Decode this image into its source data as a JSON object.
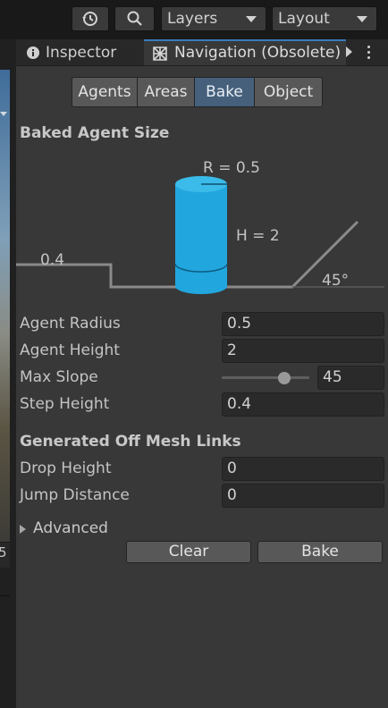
{
  "toolbar": {
    "history_icon": "history-icon",
    "search_icon": "search-icon",
    "layers_label": "Layers",
    "layout_label": "Layout"
  },
  "scene_strip": {
    "partial_value": "5"
  },
  "tabs": {
    "inspector": {
      "label": "Inspector",
      "icon": "info-icon"
    },
    "navigation": {
      "label": "Navigation (Obsolete)",
      "icon": "navmesh-icon"
    }
  },
  "segmented": [
    "Agents",
    "Areas",
    "Bake",
    "Object"
  ],
  "segmented_active": "Bake",
  "baked_agent_size": {
    "heading": "Baked Agent Size",
    "radius_label": "R = 0.5",
    "height_label": "H = 2",
    "step_label": "0.4",
    "slope_label": "45°",
    "colors": {
      "agent": "#21a6de",
      "agent_top": "#3bbbe9",
      "ground": "#8a8a8a"
    }
  },
  "agent_fields": [
    {
      "label": "Agent Radius",
      "value": "0.5"
    },
    {
      "label": "Agent Height",
      "value": "2"
    },
    {
      "label": "Max Slope",
      "value": "45"
    },
    {
      "label": "Step Height",
      "value": "0.4"
    }
  ],
  "max_slope_slider": {
    "min": 0,
    "max": 60,
    "value": 45
  },
  "off_mesh": {
    "heading": "Generated Off Mesh Links",
    "fields": [
      {
        "label": "Drop Height",
        "value": "0"
      },
      {
        "label": "Jump Distance",
        "value": "0"
      }
    ]
  },
  "advanced_label": "Advanced",
  "buttons": {
    "clear": "Clear",
    "bake": "Bake"
  },
  "colors": {
    "accent": "#3a79bb",
    "active_tab": "#46607c"
  }
}
